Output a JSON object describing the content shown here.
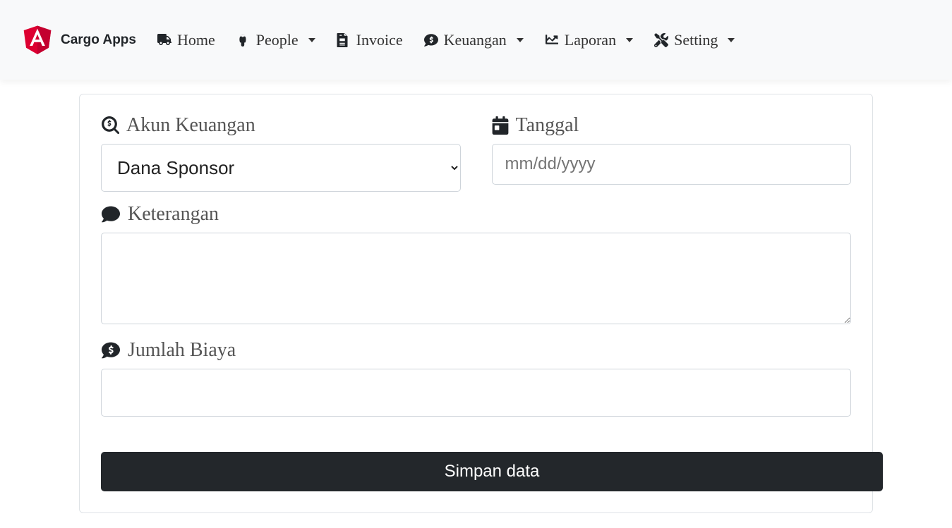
{
  "brand": {
    "name": "Cargo Apps"
  },
  "nav": {
    "home": "Home",
    "people": "People",
    "invoice": "Invoice",
    "keuangan": "Keuangan",
    "laporan": "Laporan",
    "setting": "Setting"
  },
  "form": {
    "akun_label": "Akun Keuangan",
    "akun_value": "Dana Sponsor",
    "tanggal_label": "Tanggal",
    "tanggal_placeholder": "mm/dd/yyyy",
    "keterangan_label": "Keterangan",
    "keterangan_value": "",
    "jumlah_label": "Jumlah Biaya",
    "jumlah_value": "",
    "submit_label": "Simpan data"
  }
}
